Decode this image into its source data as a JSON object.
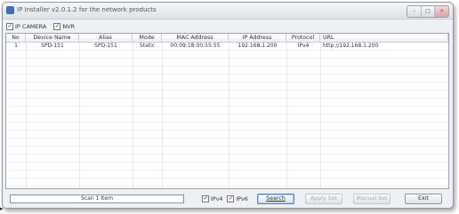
{
  "window": {
    "title": "IP Installer v2.0.1.2 for the network products"
  },
  "filters": [
    {
      "label": "IP CAMERA",
      "checked": true
    },
    {
      "label": "NVR",
      "checked": true
    }
  ],
  "table": {
    "columns": [
      "No",
      "Device Name",
      "Alias",
      "Mode",
      "MAC Address",
      "IP Address",
      "Protocol",
      "URL"
    ],
    "rows": [
      [
        "1",
        "SPD-151",
        "SPD-151",
        "Static",
        "00:09:18:00:55:55",
        "192.168.1.200",
        "IPv4",
        "http://192.168.1.200"
      ]
    ]
  },
  "status": {
    "text": "Scan 1 Item"
  },
  "protocol_options": [
    {
      "label": "IPv4",
      "checked": true
    },
    {
      "label": "IPv6",
      "checked": true
    }
  ],
  "buttons": {
    "search": "Search",
    "apply_set": "Apply Set",
    "manual_set": "Manual Set",
    "exit": "Exit"
  },
  "check_glyph": "✓"
}
